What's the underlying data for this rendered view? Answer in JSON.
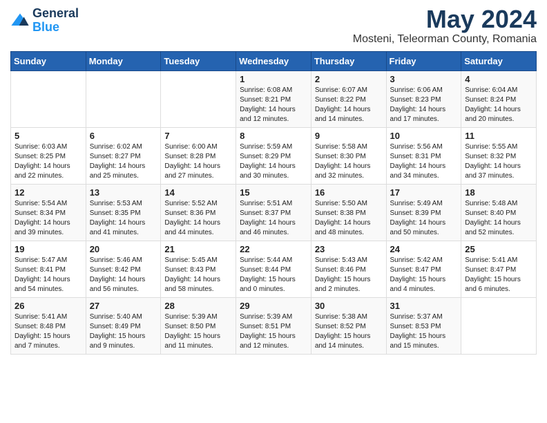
{
  "header": {
    "logo_general": "General",
    "logo_blue": "Blue",
    "title": "May 2024",
    "subtitle": "Mosteni, Teleorman County, Romania"
  },
  "days_of_week": [
    "Sunday",
    "Monday",
    "Tuesday",
    "Wednesday",
    "Thursday",
    "Friday",
    "Saturday"
  ],
  "weeks": [
    [
      {
        "day": "",
        "info": ""
      },
      {
        "day": "",
        "info": ""
      },
      {
        "day": "",
        "info": ""
      },
      {
        "day": "1",
        "info": "Sunrise: 6:08 AM\nSunset: 8:21 PM\nDaylight: 14 hours\nand 12 minutes."
      },
      {
        "day": "2",
        "info": "Sunrise: 6:07 AM\nSunset: 8:22 PM\nDaylight: 14 hours\nand 14 minutes."
      },
      {
        "day": "3",
        "info": "Sunrise: 6:06 AM\nSunset: 8:23 PM\nDaylight: 14 hours\nand 17 minutes."
      },
      {
        "day": "4",
        "info": "Sunrise: 6:04 AM\nSunset: 8:24 PM\nDaylight: 14 hours\nand 20 minutes."
      }
    ],
    [
      {
        "day": "5",
        "info": "Sunrise: 6:03 AM\nSunset: 8:25 PM\nDaylight: 14 hours\nand 22 minutes."
      },
      {
        "day": "6",
        "info": "Sunrise: 6:02 AM\nSunset: 8:27 PM\nDaylight: 14 hours\nand 25 minutes."
      },
      {
        "day": "7",
        "info": "Sunrise: 6:00 AM\nSunset: 8:28 PM\nDaylight: 14 hours\nand 27 minutes."
      },
      {
        "day": "8",
        "info": "Sunrise: 5:59 AM\nSunset: 8:29 PM\nDaylight: 14 hours\nand 30 minutes."
      },
      {
        "day": "9",
        "info": "Sunrise: 5:58 AM\nSunset: 8:30 PM\nDaylight: 14 hours\nand 32 minutes."
      },
      {
        "day": "10",
        "info": "Sunrise: 5:56 AM\nSunset: 8:31 PM\nDaylight: 14 hours\nand 34 minutes."
      },
      {
        "day": "11",
        "info": "Sunrise: 5:55 AM\nSunset: 8:32 PM\nDaylight: 14 hours\nand 37 minutes."
      }
    ],
    [
      {
        "day": "12",
        "info": "Sunrise: 5:54 AM\nSunset: 8:34 PM\nDaylight: 14 hours\nand 39 minutes."
      },
      {
        "day": "13",
        "info": "Sunrise: 5:53 AM\nSunset: 8:35 PM\nDaylight: 14 hours\nand 41 minutes."
      },
      {
        "day": "14",
        "info": "Sunrise: 5:52 AM\nSunset: 8:36 PM\nDaylight: 14 hours\nand 44 minutes."
      },
      {
        "day": "15",
        "info": "Sunrise: 5:51 AM\nSunset: 8:37 PM\nDaylight: 14 hours\nand 46 minutes."
      },
      {
        "day": "16",
        "info": "Sunrise: 5:50 AM\nSunset: 8:38 PM\nDaylight: 14 hours\nand 48 minutes."
      },
      {
        "day": "17",
        "info": "Sunrise: 5:49 AM\nSunset: 8:39 PM\nDaylight: 14 hours\nand 50 minutes."
      },
      {
        "day": "18",
        "info": "Sunrise: 5:48 AM\nSunset: 8:40 PM\nDaylight: 14 hours\nand 52 minutes."
      }
    ],
    [
      {
        "day": "19",
        "info": "Sunrise: 5:47 AM\nSunset: 8:41 PM\nDaylight: 14 hours\nand 54 minutes."
      },
      {
        "day": "20",
        "info": "Sunrise: 5:46 AM\nSunset: 8:42 PM\nDaylight: 14 hours\nand 56 minutes."
      },
      {
        "day": "21",
        "info": "Sunrise: 5:45 AM\nSunset: 8:43 PM\nDaylight: 14 hours\nand 58 minutes."
      },
      {
        "day": "22",
        "info": "Sunrise: 5:44 AM\nSunset: 8:44 PM\nDaylight: 15 hours\nand 0 minutes."
      },
      {
        "day": "23",
        "info": "Sunrise: 5:43 AM\nSunset: 8:46 PM\nDaylight: 15 hours\nand 2 minutes."
      },
      {
        "day": "24",
        "info": "Sunrise: 5:42 AM\nSunset: 8:47 PM\nDaylight: 15 hours\nand 4 minutes."
      },
      {
        "day": "25",
        "info": "Sunrise: 5:41 AM\nSunset: 8:47 PM\nDaylight: 15 hours\nand 6 minutes."
      }
    ],
    [
      {
        "day": "26",
        "info": "Sunrise: 5:41 AM\nSunset: 8:48 PM\nDaylight: 15 hours\nand 7 minutes."
      },
      {
        "day": "27",
        "info": "Sunrise: 5:40 AM\nSunset: 8:49 PM\nDaylight: 15 hours\nand 9 minutes."
      },
      {
        "day": "28",
        "info": "Sunrise: 5:39 AM\nSunset: 8:50 PM\nDaylight: 15 hours\nand 11 minutes."
      },
      {
        "day": "29",
        "info": "Sunrise: 5:39 AM\nSunset: 8:51 PM\nDaylight: 15 hours\nand 12 minutes."
      },
      {
        "day": "30",
        "info": "Sunrise: 5:38 AM\nSunset: 8:52 PM\nDaylight: 15 hours\nand 14 minutes."
      },
      {
        "day": "31",
        "info": "Sunrise: 5:37 AM\nSunset: 8:53 PM\nDaylight: 15 hours\nand 15 minutes."
      },
      {
        "day": "",
        "info": ""
      }
    ]
  ]
}
